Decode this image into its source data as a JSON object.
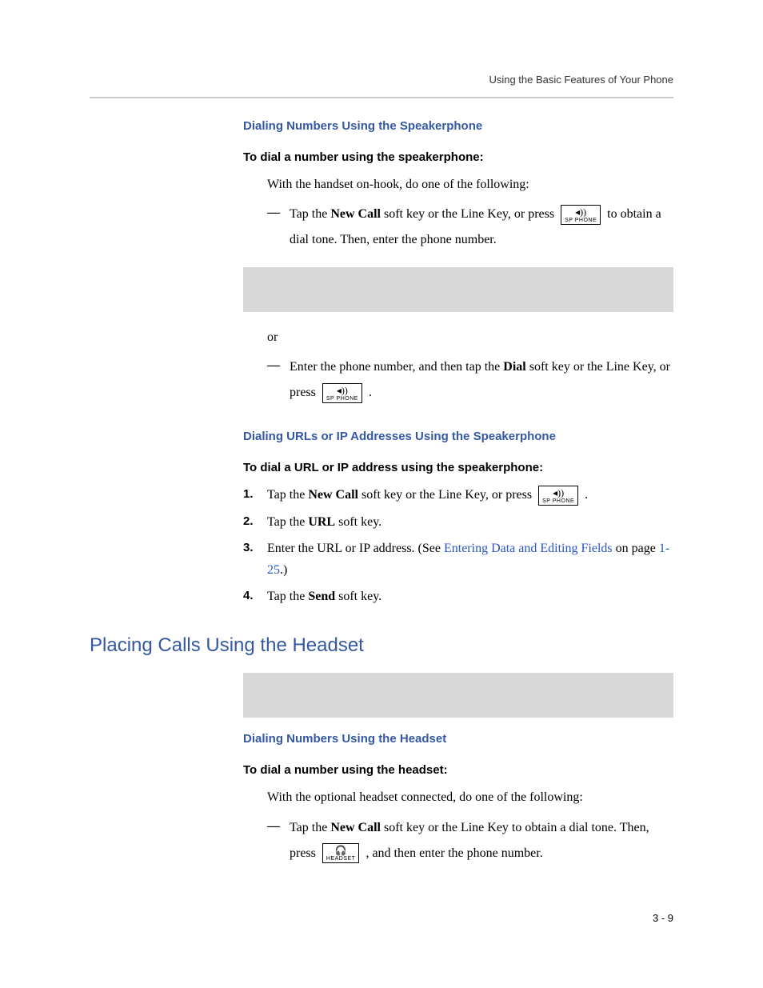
{
  "running_head": "Using the Basic Features of Your Phone",
  "sections": {
    "sec1": {
      "title": "Dialing Numbers Using the Speakerphone",
      "sub_title": "To dial a number using the speakerphone:",
      "intro": "With the handset on-hook, do one of the following:",
      "bullet1a": "Tap the ",
      "bullet1b": " soft key or the Line Key, or press ",
      "bullet1c": " to obtain a dial tone. Then, enter the phone number.",
      "new_call": "New Call",
      "or": "or",
      "bullet2a": "Enter the phone number, and then tap the ",
      "dial": "Dial",
      "bullet2b": " soft key or the Line Key, or press ",
      "bullet2c": " ."
    },
    "sec2": {
      "title": "Dialing URLs or IP Addresses Using the Speakerphone",
      "sub_title": "To dial a URL or IP address using the speakerphone:",
      "step1a": "Tap the ",
      "new_call": "New Call",
      "step1b": " soft key or the Line Key, or press ",
      "step1c": " .",
      "step2a": "Tap the ",
      "url": "URL",
      "step2b": " soft key.",
      "step3a": "Enter the URL or IP address. (See ",
      "step3link": "Entering Data and Editing Fields",
      "step3b": " on page ",
      "step3page": "1-25",
      "step3c": ".)",
      "step4a": "Tap the ",
      "send": "Send",
      "step4b": " soft key."
    },
    "sec3": {
      "title": "Placing Calls Using the Headset",
      "sub_title": "Dialing Numbers Using the Headset",
      "sub_sub": "To dial a number using the headset:",
      "intro": "With the optional headset connected, do one of the following:",
      "bullet1a": "Tap the ",
      "new_call": "New Call",
      "bullet1b": " soft key or the Line Key to obtain a dial tone. Then, press ",
      "bullet1c": " , and then enter the phone number."
    }
  },
  "icons": {
    "sp_phone_glyph": "◂))",
    "sp_phone_cap": "SP PHONE",
    "headset_glyph": "🎧",
    "headset_cap": "HEADSET"
  },
  "nums": {
    "n1": "1.",
    "n2": "2.",
    "n3": "3.",
    "n4": "4."
  },
  "dash": "—",
  "page_number": "3 - 9"
}
